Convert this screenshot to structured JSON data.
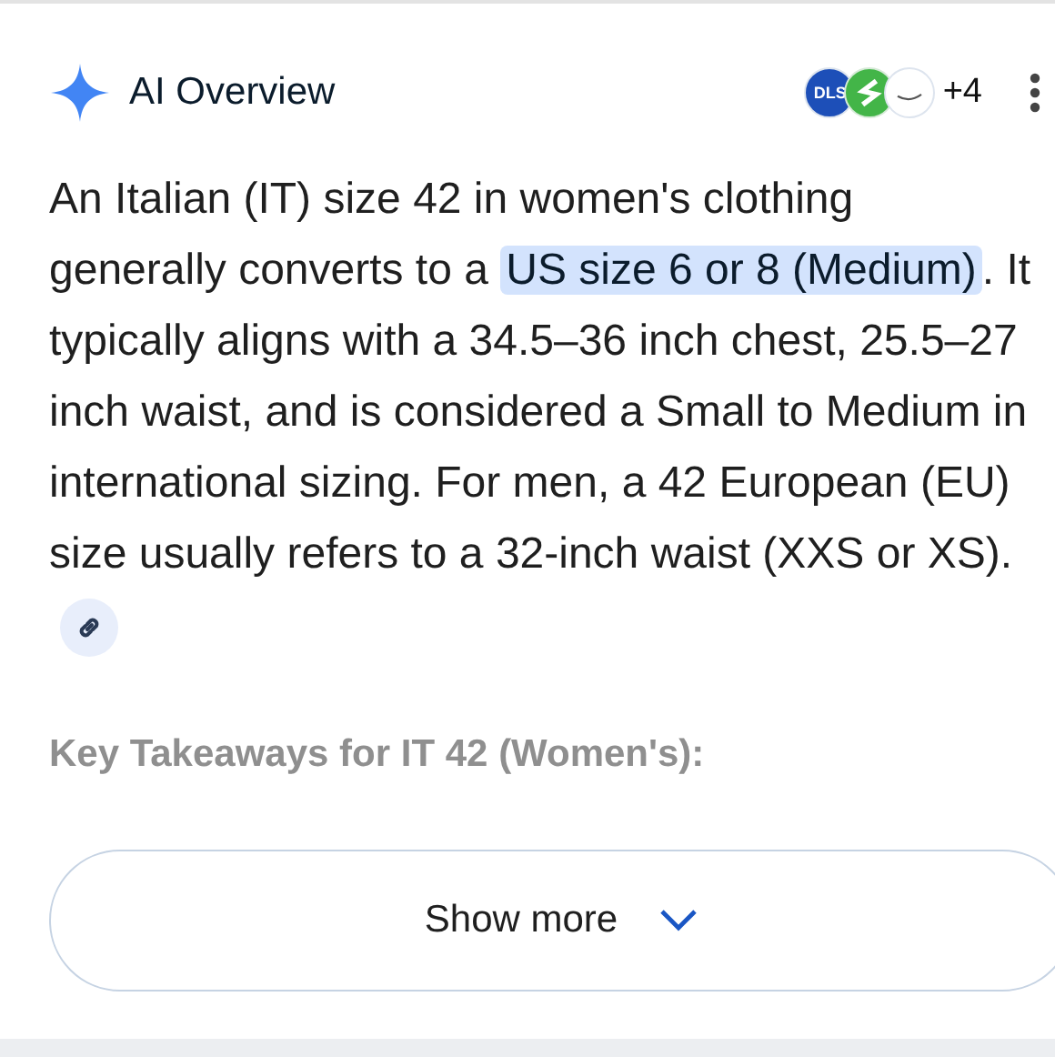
{
  "header": {
    "title": "AI Overview",
    "sources": {
      "first_logo_text": "DLS",
      "more": "+4"
    }
  },
  "answer": {
    "before": "An Italian (IT) size 42 in women's clothing generally converts to a ",
    "highlight": "US size 6 or 8 (Medium)",
    "after": ". It typically aligns with a 34.5–36 inch chest, 25.5–27 inch waist, and is considered a Small to Medium in international sizing. For men, a 42 European (EU) size usually refers to a 32-inch waist (XXS or XS)."
  },
  "subheading": "Key Takeaways for IT 42 (Women's):",
  "show_more": "Show more"
}
